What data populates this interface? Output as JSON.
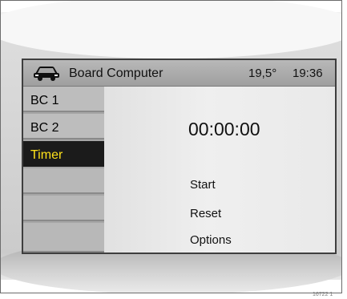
{
  "header": {
    "icon": "car-icon",
    "title": "Board Computer",
    "temperature": "19,5°",
    "time": "19:36"
  },
  "sidebar": {
    "items": [
      {
        "label": "BC 1",
        "selected": false
      },
      {
        "label": "BC 2",
        "selected": false
      },
      {
        "label": "Timer",
        "selected": true
      },
      {
        "label": "",
        "selected": false
      },
      {
        "label": "",
        "selected": false
      },
      {
        "label": "",
        "selected": false
      }
    ]
  },
  "content": {
    "timer_value": "00:00:00",
    "menu": {
      "start": "Start",
      "reset": "Reset",
      "options": "Options"
    }
  },
  "colors": {
    "selected_bg": "#1b1b1b",
    "selected_text": "#ffe21a",
    "header_bg": "#a8a8a8"
  },
  "reference_code": "16722 1"
}
